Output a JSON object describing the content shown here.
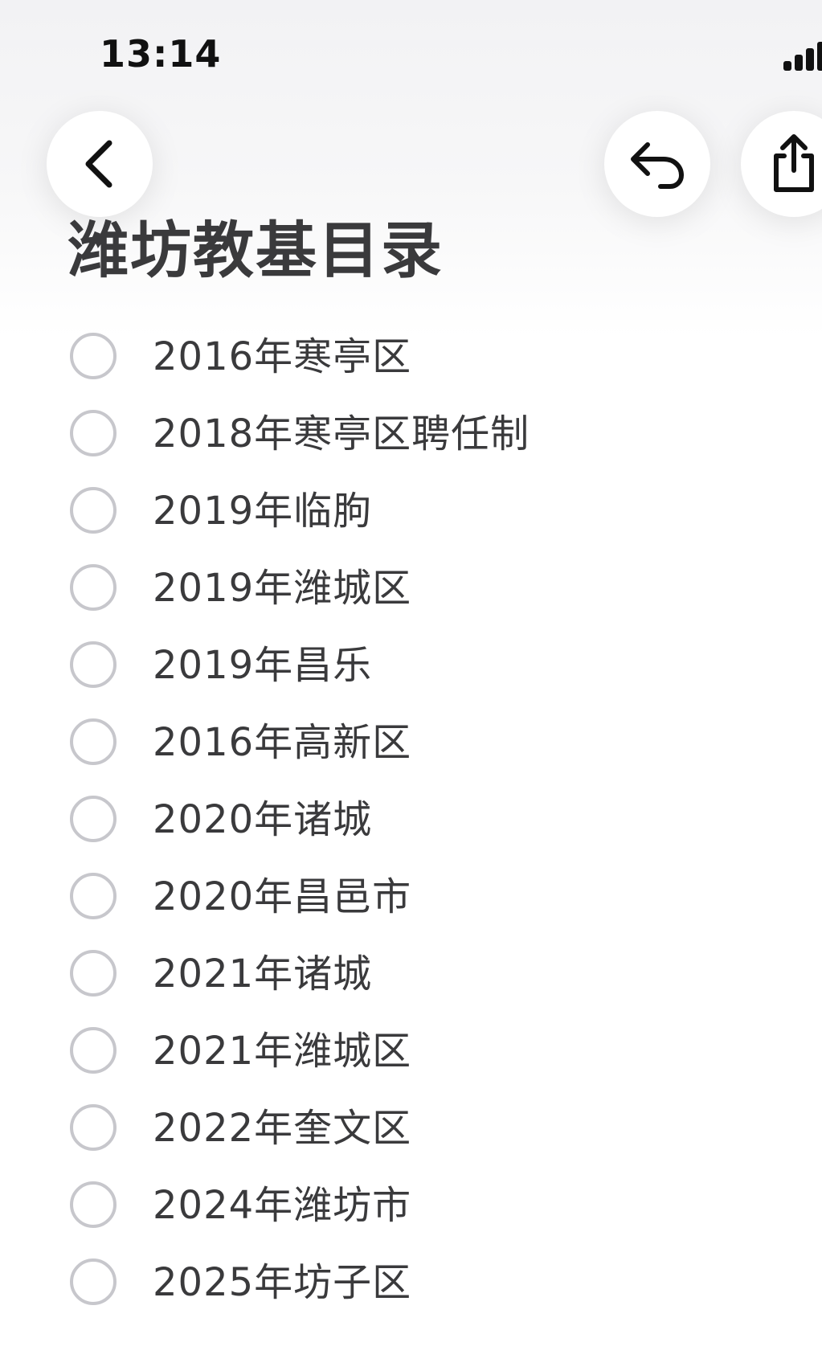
{
  "status_bar": {
    "time": "13:14",
    "signal_icon": "signal-bars-icon"
  },
  "toolbar": {
    "back_icon": "chevron-left-icon",
    "undo_icon": "undo-icon",
    "share_icon": "share-icon"
  },
  "note": {
    "title": "潍坊教基目录",
    "items": [
      {
        "label": "2016年寒亭区",
        "checked": false
      },
      {
        "label": "2018年寒亭区聘任制",
        "checked": false
      },
      {
        "label": "2019年临朐",
        "checked": false
      },
      {
        "label": "2019年潍城区",
        "checked": false
      },
      {
        "label": "2019年昌乐",
        "checked": false
      },
      {
        "label": "2016年高新区",
        "checked": false
      },
      {
        "label": "2020年诸城",
        "checked": false
      },
      {
        "label": "2020年昌邑市",
        "checked": false
      },
      {
        "label": "2021年诸城",
        "checked": false
      },
      {
        "label": "2021年潍城区",
        "checked": false
      },
      {
        "label": "2022年奎文区",
        "checked": false
      },
      {
        "label": "2024年潍坊市",
        "checked": false
      },
      {
        "label": "2025年坊子区",
        "checked": false
      }
    ]
  },
  "colors": {
    "checkbox_border": "#c7c7cc",
    "text": "#3a3a3c",
    "title": "#3a3a3c"
  }
}
